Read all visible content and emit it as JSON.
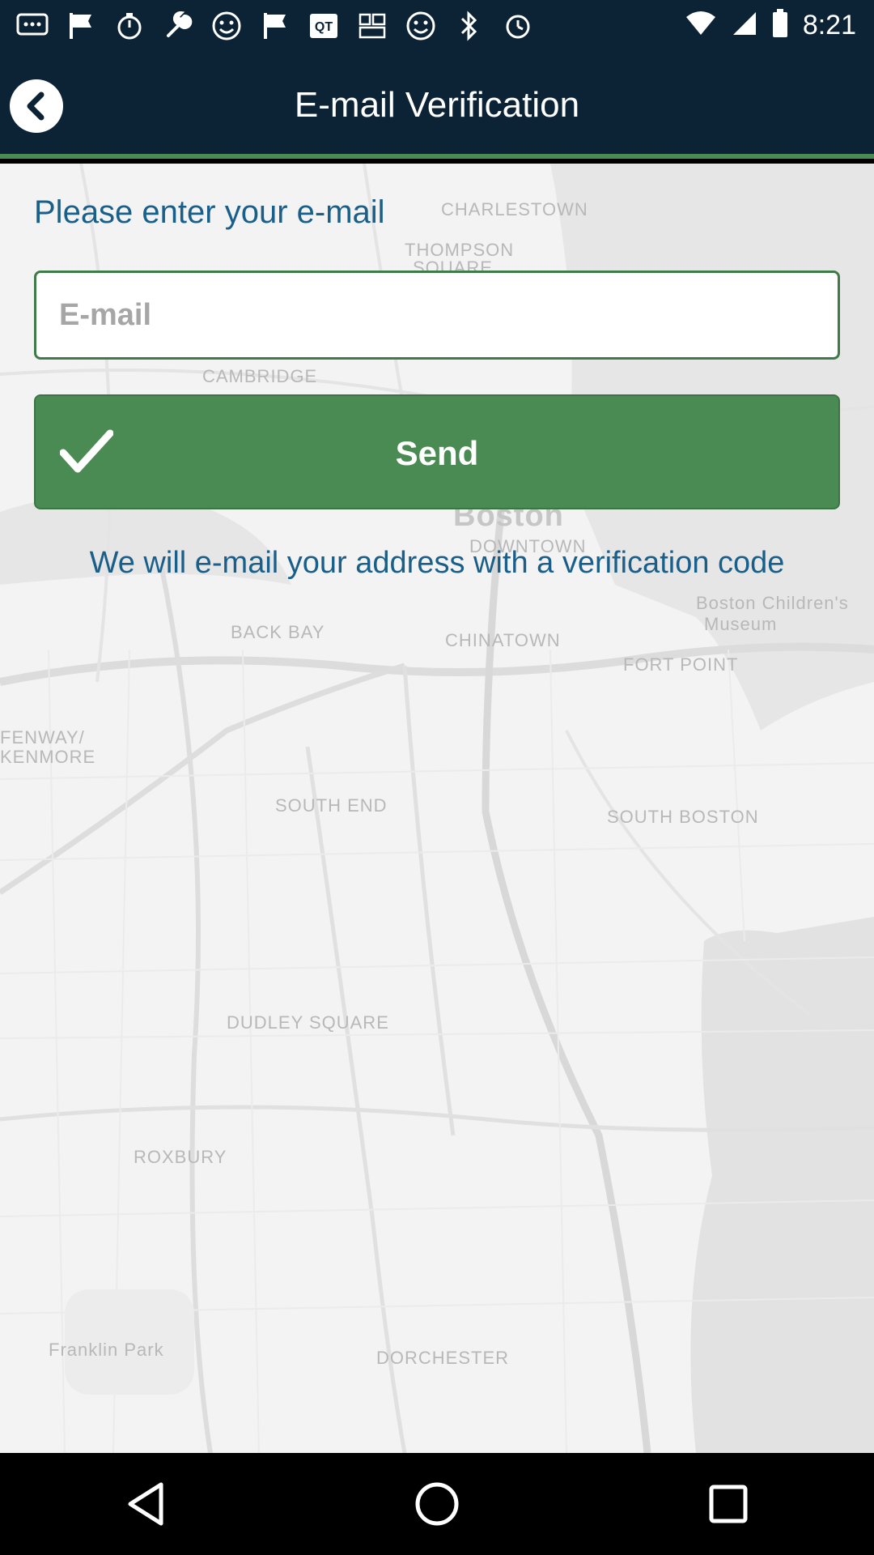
{
  "status_bar": {
    "time": "8:21",
    "icons": [
      "message-icon",
      "flag-icon",
      "timer-icon",
      "wrench-icon",
      "smiley-icon",
      "flag-icon",
      "qr-icon",
      "weather-icon",
      "smiley-icon",
      "bluetooth-icon",
      "alarm-icon",
      "wifi-icon",
      "signal-icon",
      "battery-icon"
    ]
  },
  "header": {
    "title": "E-mail Verification",
    "back_icon": "chevron-left-icon"
  },
  "form": {
    "prompt": "Please enter your e-mail",
    "email_placeholder": "E-mail",
    "email_value": "",
    "send_label": "Send",
    "info": "We will e-mail your address with a verification code"
  },
  "map_labels": {
    "charlestown": "CHARLESTOWN",
    "thompson": "THOMPSON",
    "square": "SQUARE",
    "cambridge": "CAMBRIDGE",
    "boston": "Boston",
    "downtown": "DOWNTOWN",
    "boston_childrens": "Boston Children's",
    "museum": "Museum",
    "back_bay": "BACK BAY",
    "chinatown": "CHINATOWN",
    "fort_point": "FORT POINT",
    "fenway": "FENWAY/",
    "kenmore": "KENMORE",
    "south_end": "SOUTH END",
    "south_boston": "SOUTH BOSTON",
    "dudley": "DUDLEY SQUARE",
    "roxbury": "ROXBURY",
    "dorchester": "DORCHESTER",
    "franklin_park": "Franklin Park"
  },
  "colors": {
    "header_bg": "#0c2235",
    "accent_green": "#4a8a53",
    "text_blue": "#1a5f8a"
  }
}
